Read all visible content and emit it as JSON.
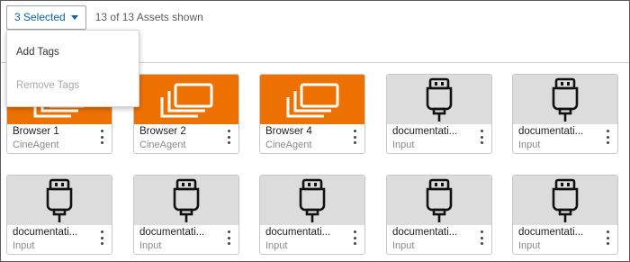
{
  "toolbar": {
    "selected_label": "3 Selected",
    "shown_text": "13 of 13 Assets shown"
  },
  "menu": {
    "items": [
      {
        "label": "Add Tags",
        "disabled": false
      },
      {
        "label": "Remove Tags",
        "disabled": true
      }
    ]
  },
  "colors": {
    "accent": "#0a62a8",
    "agent_tile": "#ec7100",
    "input_tile": "#dcdcdc"
  },
  "assets": [
    {
      "title": "Browser 1",
      "subtitle": "CineAgent",
      "icon": "browser-windows-icon"
    },
    {
      "title": "Browser 2",
      "subtitle": "CineAgent",
      "icon": "browser-windows-icon"
    },
    {
      "title": "Browser 4",
      "subtitle": "CineAgent",
      "icon": "browser-windows-icon"
    },
    {
      "title": "documentati...",
      "subtitle": "Input",
      "icon": "plug-icon"
    },
    {
      "title": "documentati...",
      "subtitle": "Input",
      "icon": "plug-icon"
    },
    {
      "title": "documentati...",
      "subtitle": "Input",
      "icon": "plug-icon"
    },
    {
      "title": "documentati...",
      "subtitle": "Input",
      "icon": "plug-icon"
    },
    {
      "title": "documentati...",
      "subtitle": "Input",
      "icon": "plug-icon"
    },
    {
      "title": "documentati...",
      "subtitle": "Input",
      "icon": "plug-icon"
    },
    {
      "title": "documentati...",
      "subtitle": "Input",
      "icon": "plug-icon"
    }
  ]
}
